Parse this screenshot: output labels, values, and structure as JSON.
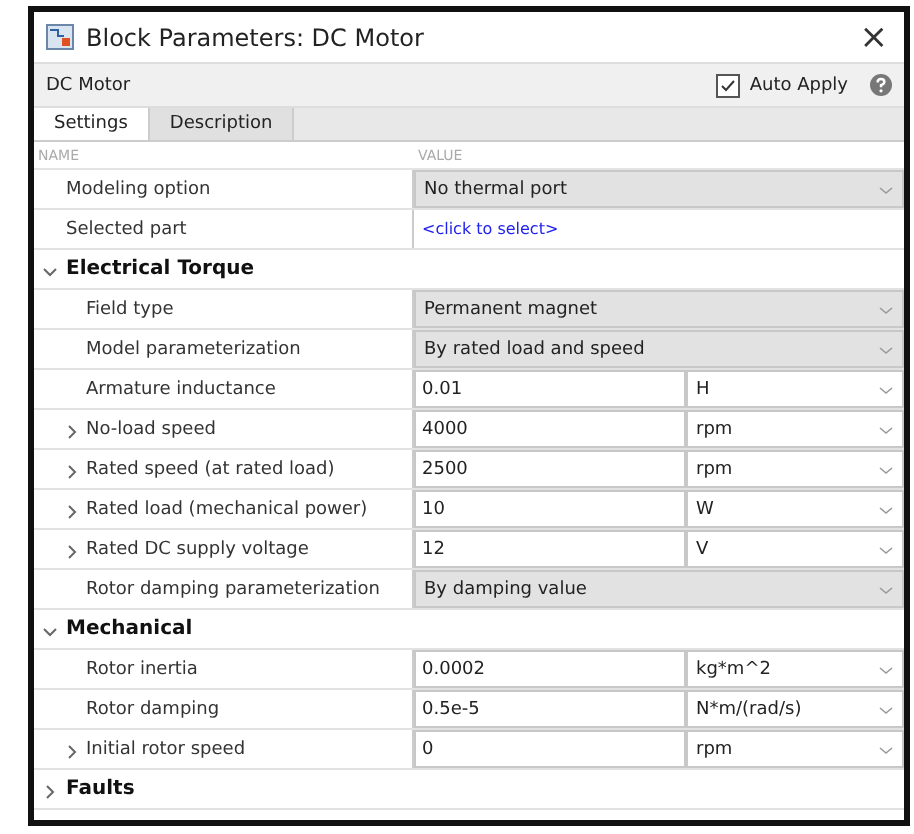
{
  "window": {
    "title": "Block Parameters: DC Motor",
    "close": "×"
  },
  "header": {
    "block_name": "DC Motor",
    "auto_apply": {
      "label": "Auto Apply",
      "checked": true
    }
  },
  "tabs": [
    {
      "label": "Settings",
      "selected": true
    },
    {
      "label": "Description",
      "selected": false
    }
  ],
  "columns": [
    "NAME",
    "VALUE"
  ],
  "rows": [
    {
      "kind": "dropdown",
      "name": "Modeling option",
      "value": "No thermal port"
    },
    {
      "kind": "link",
      "name": "Selected part",
      "value": "<click to select>"
    }
  ],
  "sections": [
    {
      "title": "Electrical Torque",
      "expanded": true,
      "rows": [
        {
          "kind": "dropdown",
          "name": "Field type",
          "value": "Permanent magnet"
        },
        {
          "kind": "dropdown",
          "name": "Model parameterization",
          "value": "By rated load and speed"
        },
        {
          "kind": "value_unit",
          "name": "Armature inductance",
          "value": "0.01",
          "unit": "H"
        },
        {
          "kind": "value_unit",
          "name": "No-load speed",
          "value": "4000",
          "unit": "rpm",
          "expanded": false
        },
        {
          "kind": "value_unit",
          "name": "Rated speed (at rated load)",
          "value": "2500",
          "unit": "rpm",
          "expanded": false
        },
        {
          "kind": "value_unit",
          "name": "Rated load (mechanical power)",
          "value": "10",
          "unit": "W",
          "expanded": false
        },
        {
          "kind": "value_unit",
          "name": "Rated DC supply voltage",
          "value": "12",
          "unit": "V",
          "expanded": false
        },
        {
          "kind": "dropdown",
          "name": "Rotor damping parameterization",
          "value": "By damping value"
        }
      ]
    },
    {
      "title": "Mechanical",
      "expanded": true,
      "rows": [
        {
          "kind": "value_unit",
          "name": "Rotor inertia",
          "value": "0.0002",
          "unit": "kg*m^2"
        },
        {
          "kind": "value_unit",
          "name": "Rotor damping",
          "value": "0.5e-5",
          "unit": "N*m/(rad/s)"
        },
        {
          "kind": "value_unit",
          "name": "Initial rotor speed",
          "value": "0",
          "unit": "rpm",
          "expanded": false
        }
      ]
    },
    {
      "title": "Faults",
      "expanded": false
    }
  ]
}
